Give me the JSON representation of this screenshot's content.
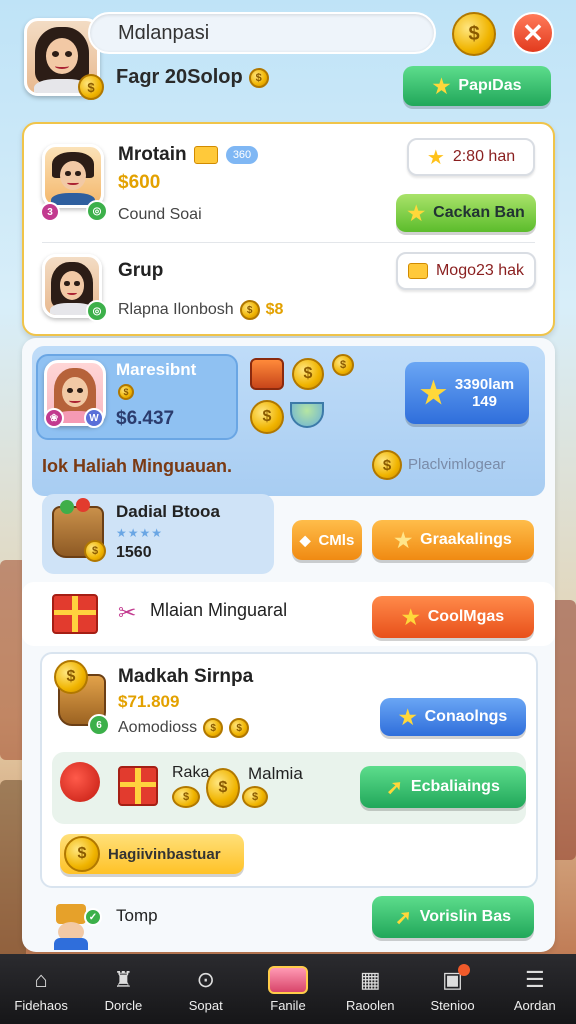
{
  "header": {
    "player_name": "Mɑlanpasi",
    "gold_text": "Fagr 20Solop",
    "top_button": "PapıDas"
  },
  "friends": [
    {
      "name": "Mrotain",
      "amount": "$600",
      "sub": "Cound Soai",
      "pill": "2:80 han",
      "action": "Cackan Ban",
      "level": "3"
    },
    {
      "name": "Grup",
      "sub": "Rlapna Ilonbosh",
      "sub_suffix": "$8",
      "pill": "Mogo23 hak"
    }
  ],
  "featured": {
    "name": "Maresibnt",
    "amount": "$6.437",
    "reward_line1": "3390lam",
    "reward_line2": "149",
    "banner": "Iok Haliah Minguauan.",
    "banner_right": "Placlvimlogear"
  },
  "daily": {
    "title": "Dadial Btooa",
    "value": "1560",
    "small_button": "CMls",
    "big_button": "Graakalings"
  },
  "weekly": {
    "title": "Mlaian Minguaral",
    "button": "CoolMgas"
  },
  "offers": [
    {
      "title": "Madkah Sirnpa",
      "price": "$71.809",
      "sub": "Aomodioss",
      "button": "Conaolngs"
    },
    {
      "title": "Raka",
      "title2": "Malmia",
      "button": "Ecbaliaings"
    }
  ],
  "pill_button": "Hagiivinbastuar",
  "last": {
    "title": "Tomp",
    "button": "Vorislin Bas"
  },
  "nav": [
    {
      "label": "Fidehaos",
      "icon": "home-icon"
    },
    {
      "label": "Dorcle",
      "icon": "castle-icon"
    },
    {
      "label": "Sopat",
      "icon": "search-icon"
    },
    {
      "label": "Fanile",
      "icon": "basket-icon"
    },
    {
      "label": "Raoolen",
      "icon": "calendar-icon"
    },
    {
      "label": "Stenioo",
      "icon": "store-icon"
    },
    {
      "label": "Aordan",
      "icon": "menu-icon"
    }
  ]
}
